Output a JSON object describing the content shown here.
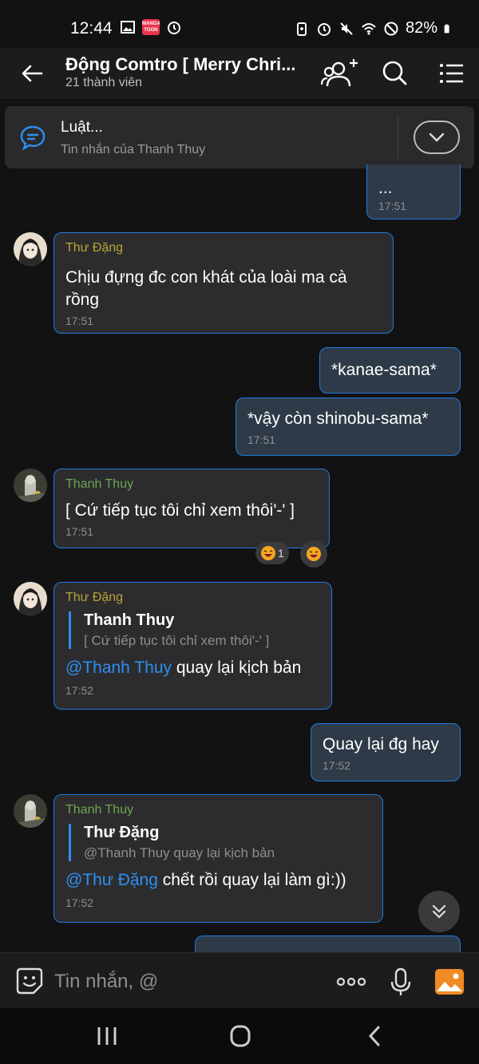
{
  "status_bar": {
    "time": "12:44",
    "manga_badge": "MANGA TOON",
    "battery": "82%",
    "icons": [
      "image-icon",
      "manga-toon-icon",
      "alarm-icon",
      "battery-saver-icon",
      "alarm-icon",
      "mute-icon",
      "wifi-icon",
      "do-not-disturb-icon",
      "battery-icon"
    ]
  },
  "header": {
    "title": "Động Comtro [ Merry Chri...",
    "subtitle": "21 thành viên",
    "icons": [
      "back-arrow-icon",
      "add-member-icon",
      "search-icon",
      "menu-list-icon"
    ]
  },
  "pinned": {
    "title": "Luật...",
    "subtitle": "Tin nhắn của Thanh Thuy",
    "icon": "chat-bubble-icon",
    "expand_icon": "chevron-down-icon"
  },
  "messages": [
    {
      "id": "m0",
      "direction": "out",
      "text": "...",
      "time": "17:51"
    },
    {
      "id": "m1",
      "direction": "in",
      "sender": "Thư Đặng",
      "text": "Chịu đựng đc con khát của loài ma cà rồng",
      "time": "17:51"
    },
    {
      "id": "m2",
      "direction": "out",
      "text": "*kanae-sama*"
    },
    {
      "id": "m3",
      "direction": "out",
      "text": "*vậy còn shinobu-sama*",
      "time": "17:51"
    },
    {
      "id": "m4",
      "direction": "in",
      "sender": "Thanh Thuy",
      "text": "[ Cứ tiếp tục tôi chỉ xem thôi'-' ]",
      "time": "17:51",
      "reaction_count": "1",
      "reaction_icon": "laughing-emoji-icon"
    },
    {
      "id": "m5",
      "direction": "in",
      "sender": "Thư Đặng",
      "quote_name": "Thanh Thuy",
      "quote_text": "[ Cứ tiếp tục tôi chỉ xem thôi'-' ]",
      "mention": "@Thanh Thuy",
      "text": " quay lại kịch bản",
      "time": "17:52"
    },
    {
      "id": "m6",
      "direction": "out",
      "text": "Quay lại đg hay",
      "time": "17:52"
    },
    {
      "id": "m7",
      "direction": "in",
      "sender": "Thanh Thuy",
      "quote_name": "Thư Đặng",
      "quote_text": "@Thanh Thuy quay lại kịch bản",
      "mention": "@Thư Đặng",
      "text": " chết rồi quay lại làm gì:))",
      "time": "17:52"
    }
  ],
  "input_bar": {
    "placeholder": "Tin nhắn, @",
    "icons": [
      "sticker-icon",
      "more-dots-icon",
      "microphone-icon",
      "gallery-icon"
    ]
  },
  "nav_bar": {
    "icons": [
      "recent-apps-icon",
      "home-icon",
      "back-icon"
    ]
  },
  "colors": {
    "accent": "#1f7ae0",
    "mention": "#2e8fef",
    "sender_thu": "#b8a533",
    "sender_thuy": "#6aa84f",
    "bubble_in": "#2c2c2e",
    "bubble_out": "#2f3a48"
  }
}
